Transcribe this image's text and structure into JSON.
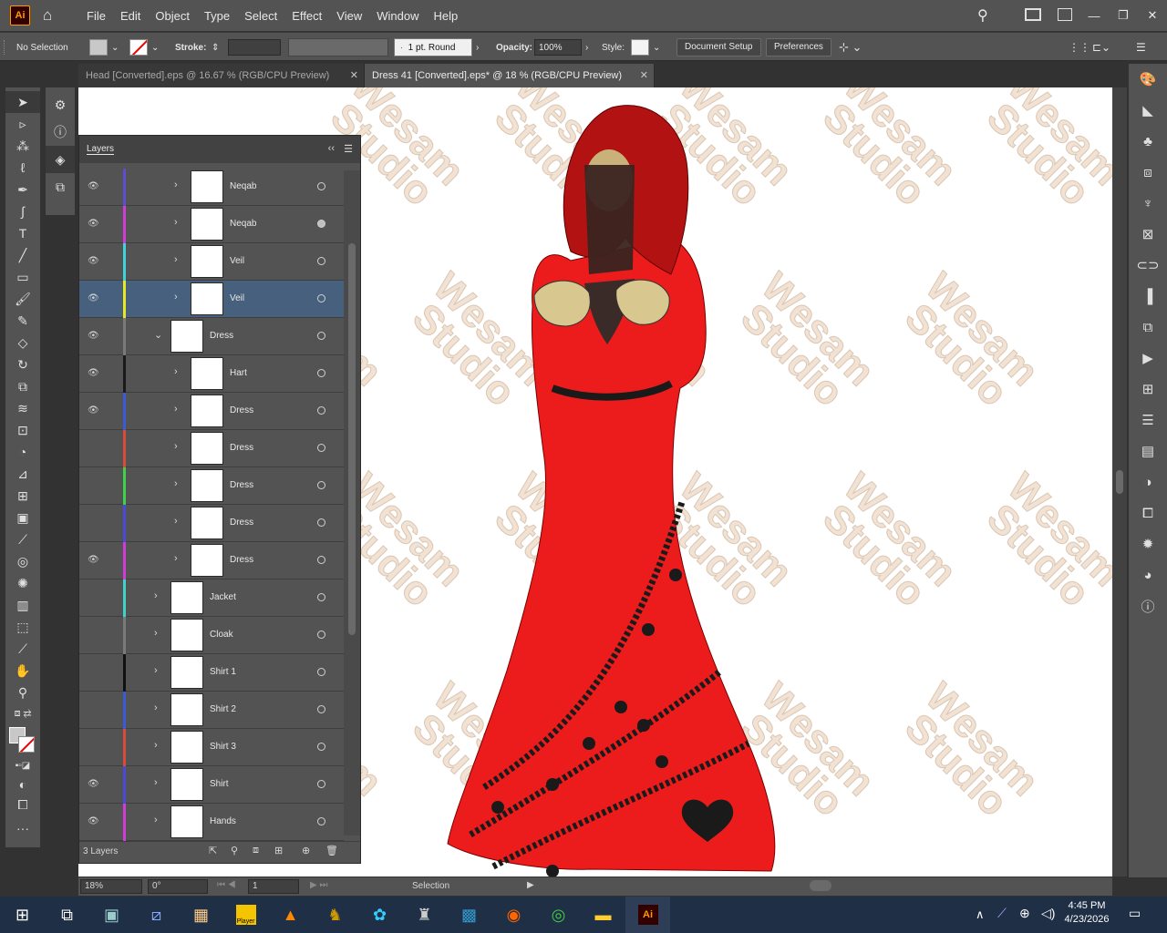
{
  "app": {
    "logo_text": "Ai",
    "window_controls": [
      "—",
      "❐",
      "✕"
    ]
  },
  "menu": [
    "File",
    "Edit",
    "Object",
    "Type",
    "Select",
    "Effect",
    "View",
    "Window",
    "Help"
  ],
  "control_bar": {
    "selection_label": "No Selection",
    "stroke_label": "Stroke:",
    "brush_profile": "1 pt. Round",
    "opacity_label": "Opacity:",
    "opacity_value": "100%",
    "style_label": "Style:",
    "document_setup": "Document Setup",
    "preferences": "Preferences"
  },
  "tabs": [
    {
      "label": "Head [Converted].eps @ 16.67 % (RGB/CPU Preview)",
      "active": false
    },
    {
      "label": "Dress 41 [Converted].eps* @ 18 % (RGB/CPU Preview)",
      "active": true
    }
  ],
  "layers_panel": {
    "title": "Layers",
    "footer_count": "3 Layers",
    "rows": [
      {
        "name": "Neqab",
        "visible": true,
        "color": "#5b4fd0",
        "expanded": false,
        "indent": 2,
        "selected": false
      },
      {
        "name": "Neqab",
        "visible": true,
        "color": "#d23cd6",
        "expanded": false,
        "indent": 2,
        "selected": false
      },
      {
        "name": "Veil",
        "visible": true,
        "color": "#3fd2d6",
        "expanded": false,
        "indent": 2,
        "selected": false
      },
      {
        "name": "Veil",
        "visible": true,
        "color": "#e8e820",
        "expanded": false,
        "indent": 2,
        "selected": true
      },
      {
        "name": "Dress",
        "visible": true,
        "color": "#7a7a7a",
        "expanded": true,
        "indent": 1,
        "selected": false
      },
      {
        "name": "Hart",
        "visible": true,
        "color": "#1a1a1a",
        "expanded": false,
        "indent": 2,
        "selected": false
      },
      {
        "name": "Dress",
        "visible": true,
        "color": "#3a5ad6",
        "expanded": false,
        "indent": 2,
        "selected": false
      },
      {
        "name": "Dress",
        "visible": false,
        "color": "#d84a3a",
        "expanded": false,
        "indent": 2,
        "selected": false
      },
      {
        "name": "Dress",
        "visible": false,
        "color": "#3ed24a",
        "expanded": false,
        "indent": 2,
        "selected": false
      },
      {
        "name": "Dress",
        "visible": false,
        "color": "#4a4ad6",
        "expanded": false,
        "indent": 2,
        "selected": false
      },
      {
        "name": "Dress",
        "visible": true,
        "color": "#d23cd6",
        "expanded": false,
        "indent": 2,
        "selected": false
      },
      {
        "name": "Jacket",
        "visible": false,
        "color": "#3fd2c6",
        "expanded": false,
        "indent": 1,
        "selected": false
      },
      {
        "name": "Cloak",
        "visible": false,
        "color": "#7a7a7a",
        "expanded": false,
        "indent": 1,
        "selected": false
      },
      {
        "name": "Shirt 1",
        "visible": false,
        "color": "#111111",
        "expanded": false,
        "indent": 1,
        "selected": false
      },
      {
        "name": "Shirt 2",
        "visible": false,
        "color": "#3a5ad6",
        "expanded": false,
        "indent": 1,
        "selected": false
      },
      {
        "name": "Shirt 3",
        "visible": false,
        "color": "#d84a3a",
        "expanded": false,
        "indent": 1,
        "selected": false
      },
      {
        "name": "Shirt",
        "visible": true,
        "color": "#4a4ad6",
        "expanded": false,
        "indent": 1,
        "selected": false
      },
      {
        "name": "Hands",
        "visible": true,
        "color": "#d23cd6",
        "expanded": false,
        "indent": 1,
        "selected": false
      }
    ]
  },
  "canvas": {
    "watermark": [
      "Wesam",
      "Studio"
    ]
  },
  "status_bar": {
    "zoom": "18%",
    "rotation": "0°",
    "artboard": "1",
    "tool": "Selection"
  },
  "taskbar": {
    "time": "4:45 PM",
    "date": "4/23/2026",
    "player_label": "Player"
  }
}
